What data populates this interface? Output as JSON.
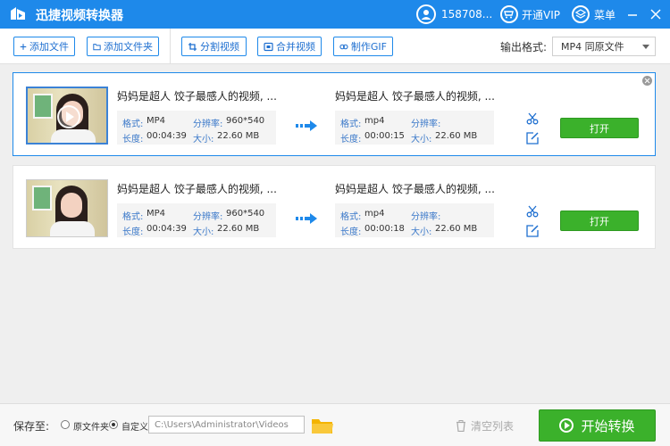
{
  "app": {
    "title": "迅捷视频转换器",
    "user_phone": "158708...",
    "vip_label": "开通VIP",
    "menu_label": "菜单"
  },
  "toolbar": {
    "add_file": "添加文件",
    "add_folder": "添加文件夹",
    "split_video": "分割视频",
    "merge_video": "合并视频",
    "make_gif": "制作GIF",
    "output_format_label": "输出格式:",
    "output_format_value": "MP4  同原文件"
  },
  "labels": {
    "format": "格式:",
    "resolution": "分辨率:",
    "duration": "长度:",
    "size": "大小:",
    "open": "打开"
  },
  "files": [
    {
      "selected": true,
      "source": {
        "title": "妈妈是超人 饺子最感人的视频, ...",
        "format": "MP4",
        "resolution": "960*540",
        "duration": "00:04:39",
        "size": "22.60 MB"
      },
      "output": {
        "title": "妈妈是超人 饺子最感人的视频, ...",
        "format": "mp4",
        "resolution": "",
        "duration": "00:00:15",
        "size": "22.60 MB"
      }
    },
    {
      "selected": false,
      "source": {
        "title": "妈妈是超人 饺子最感人的视频, ...",
        "format": "MP4",
        "resolution": "960*540",
        "duration": "00:04:39",
        "size": "22.60 MB"
      },
      "output": {
        "title": "妈妈是超人 饺子最感人的视频, ...",
        "format": "mp4",
        "resolution": "",
        "duration": "00:00:18",
        "size": "22.60 MB"
      }
    }
  ],
  "bottom": {
    "save_to_label": "保存至:",
    "option_original": "原文件夹",
    "option_custom": "自定义",
    "save_path": "C:\\Users\\Administrator\\Videos",
    "clear_list": "清空列表",
    "start_convert": "开始转换"
  },
  "colors": {
    "primary": "#1e89ea",
    "accent_green": "#3bb12b",
    "label_blue": "#3a78c9"
  }
}
